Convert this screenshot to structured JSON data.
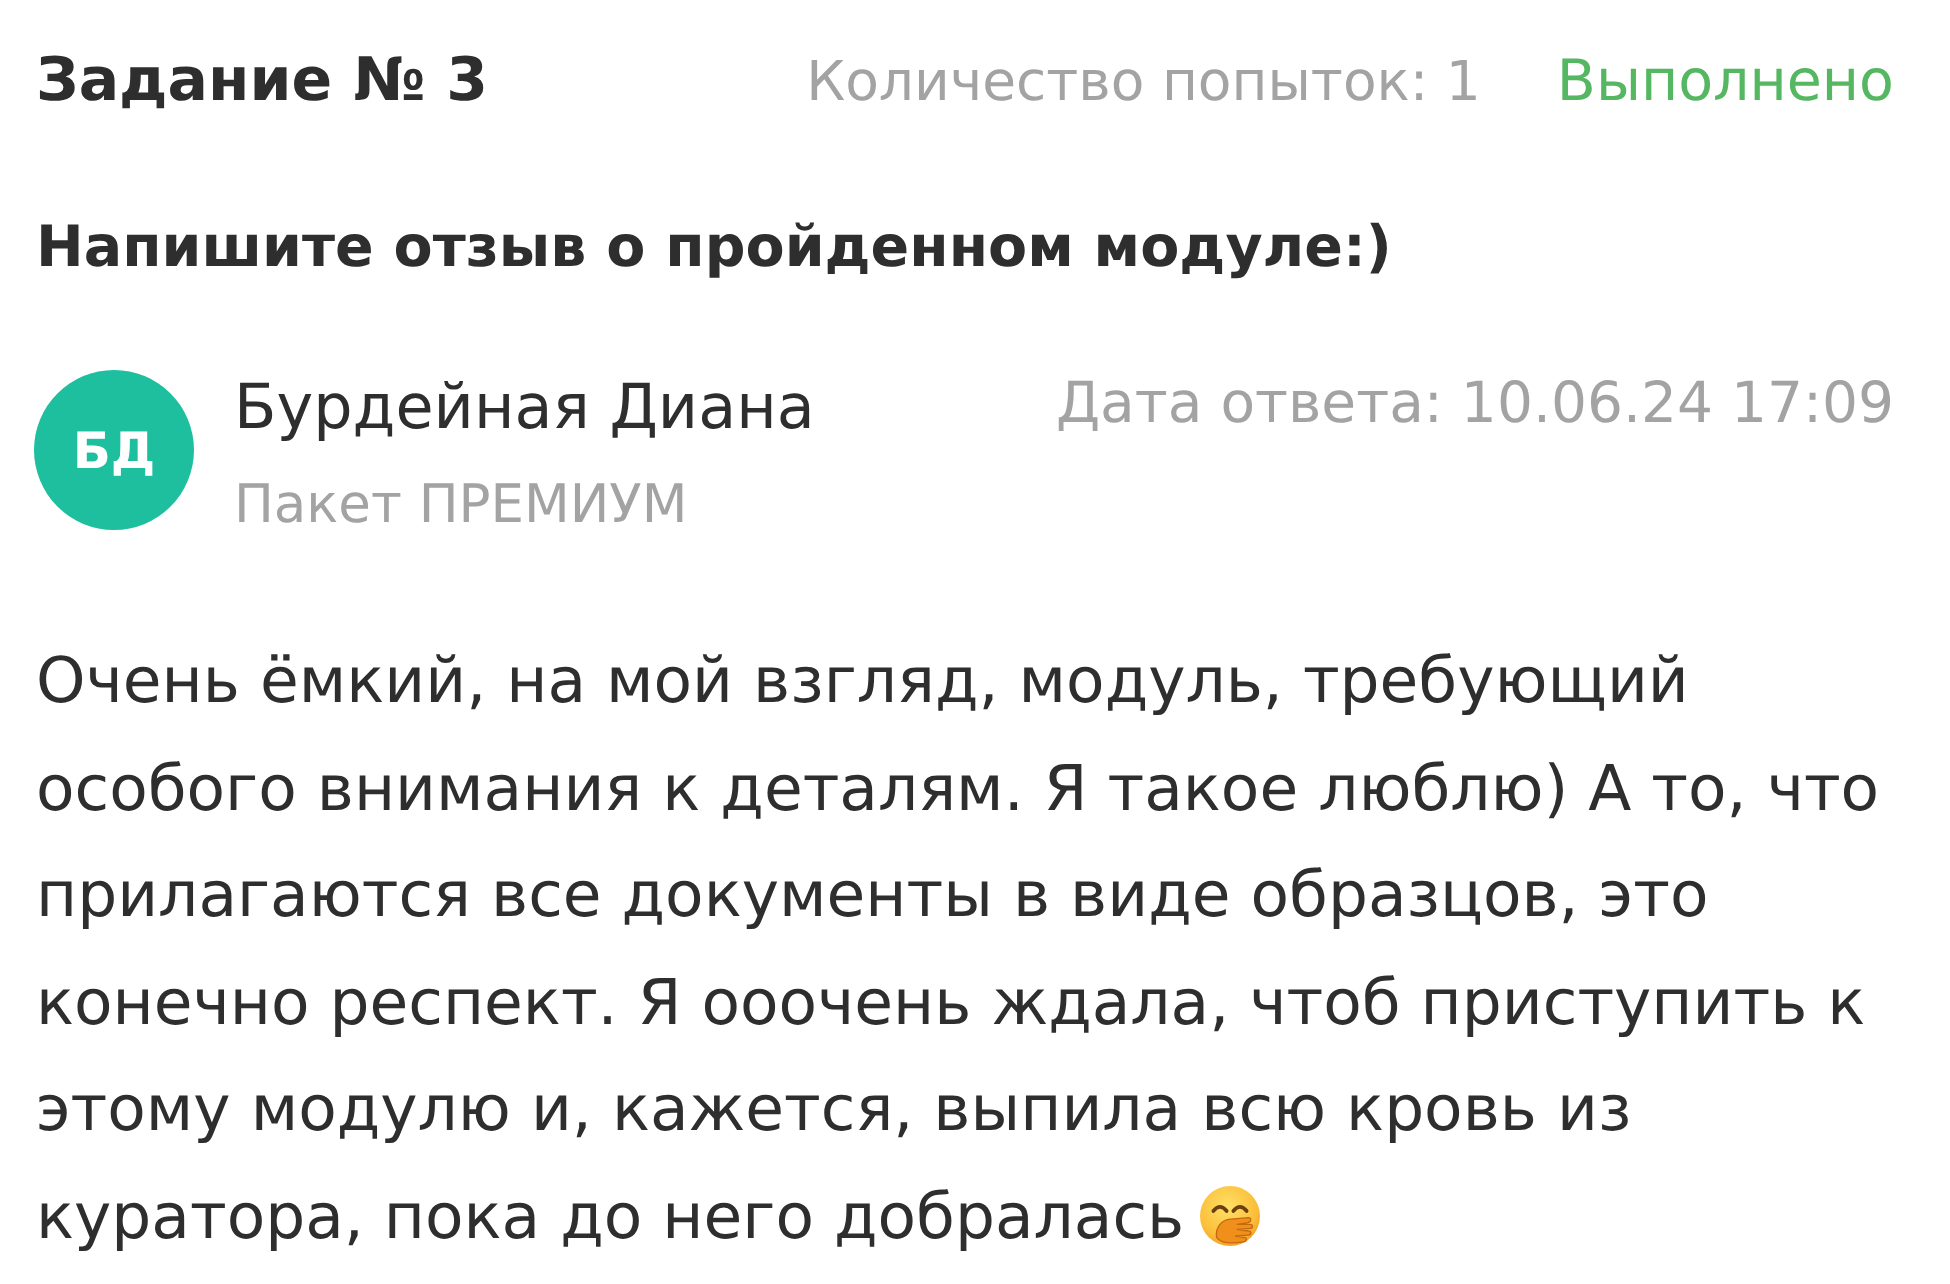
{
  "task": {
    "title": "Задание № 3",
    "attempts": "Количество попыток: 1",
    "status": {
      "label": "Выполнено",
      "done": true
    }
  },
  "question": "Напишите отзыв о пройденном модуле:)",
  "answer": {
    "author": {
      "initials": "БД",
      "name": "Бурдейная Диана",
      "plan": "Пакет ПРЕМИУМ"
    },
    "date": "Дата ответа: 10.06.24 17:09",
    "text": "Очень ёмкий, на мой взгляд, модуль, требующий особого внимания к деталям. Я такое люблю) А то, что прилагаются все документы в виде образцов, это конечно респект. Я ооочень ждала, чтоб приступить к этому модулю и, кажется, выпила всю кровь из куратора, пока до него добралась"
  }
}
